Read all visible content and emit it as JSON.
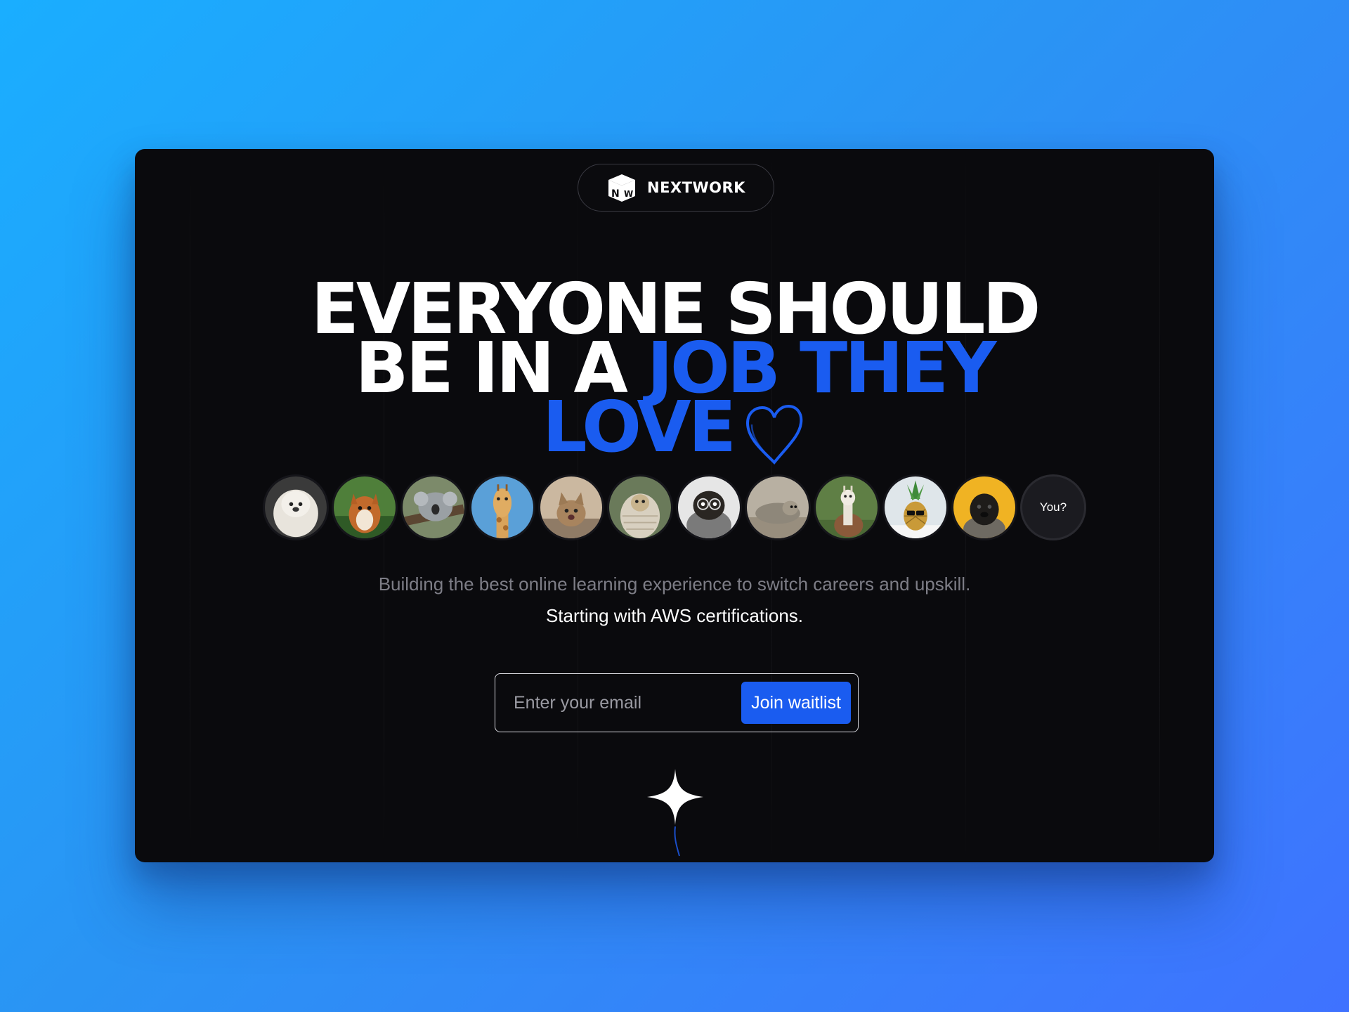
{
  "brand": {
    "name": "NEXTWORK",
    "logo_icon": "nextwork-cube-logo"
  },
  "headline": {
    "line1": "EVERYONE SHOULD",
    "line2_white": "BE IN A ",
    "line2_accent": "JOB THEY",
    "line3_accent": "LOVE",
    "accent_color": "#1a5cf0",
    "decoration_icon": "heart-outline-icon"
  },
  "avatars": {
    "items": [
      "fluffy-white-dog",
      "red-squirrel",
      "sleeping-koala",
      "giraffe",
      "tabby-kitten",
      "pug-in-blanket",
      "pug-with-glasses",
      "lying-seal",
      "alpaca",
      "pineapple-with-sunglasses",
      "black-pug-on-yellow"
    ],
    "cta_label": "You?"
  },
  "subtitle": {
    "line1": "Building the best online learning experience to switch careers and upskill.",
    "line2": "Starting with AWS certifications."
  },
  "signup": {
    "email_placeholder": "Enter your email",
    "email_value": "",
    "button_label": "Join waitlist"
  },
  "colors": {
    "background_start": "#1aaeff",
    "background_end": "#3f72ff",
    "card": "#0a0a0d",
    "accent": "#1a5cf0"
  }
}
